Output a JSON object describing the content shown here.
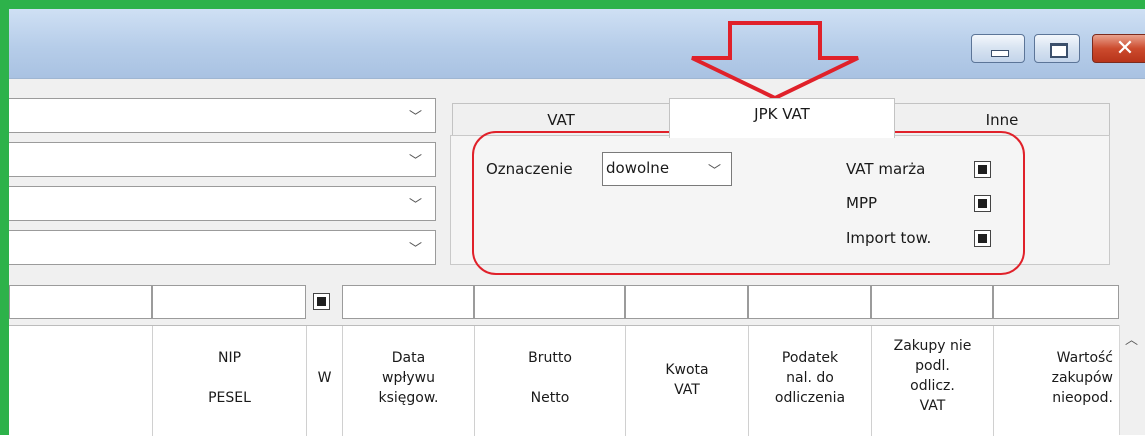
{
  "window": {
    "min_label": "",
    "max_label": "",
    "close_label": "✕"
  },
  "colors": {
    "highlight_red": "#e0212a",
    "frame_green": "#2db24a"
  },
  "tabs": [
    {
      "label": "VAT",
      "active": false
    },
    {
      "label": "JPK VAT",
      "active": true
    },
    {
      "label": "Inne",
      "active": false
    }
  ],
  "jpk": {
    "oznaczenie_label": "Oznaczenie",
    "oznaczenie_value": "dowolne",
    "vat_marza_label": "VAT marża",
    "mpp_label": "MPP",
    "import_label": "Import tow."
  },
  "columns": [
    {
      "lines": [
        ""
      ]
    },
    {
      "lines": [
        "NIP",
        "",
        "PESEL"
      ]
    },
    {
      "lines": [
        "W"
      ]
    },
    {
      "lines": [
        "Data",
        "wpływu",
        "księgow."
      ]
    },
    {
      "lines": [
        "Brutto",
        "",
        "Netto"
      ]
    },
    {
      "lines": [
        "Kwota",
        "VAT"
      ]
    },
    {
      "lines": [
        "Podatek",
        "nal. do",
        "odliczenia"
      ]
    },
    {
      "lines": [
        "Zakupy nie",
        "podl.",
        "odlicz.",
        "VAT"
      ]
    },
    {
      "lines": [
        "Wartość",
        "zakupów",
        "nieopod."
      ]
    }
  ],
  "icons": {
    "chevron": "chevron-down-icon",
    "arrow": "red-down-arrow-icon",
    "scroll_up": "chevron-up-icon"
  }
}
